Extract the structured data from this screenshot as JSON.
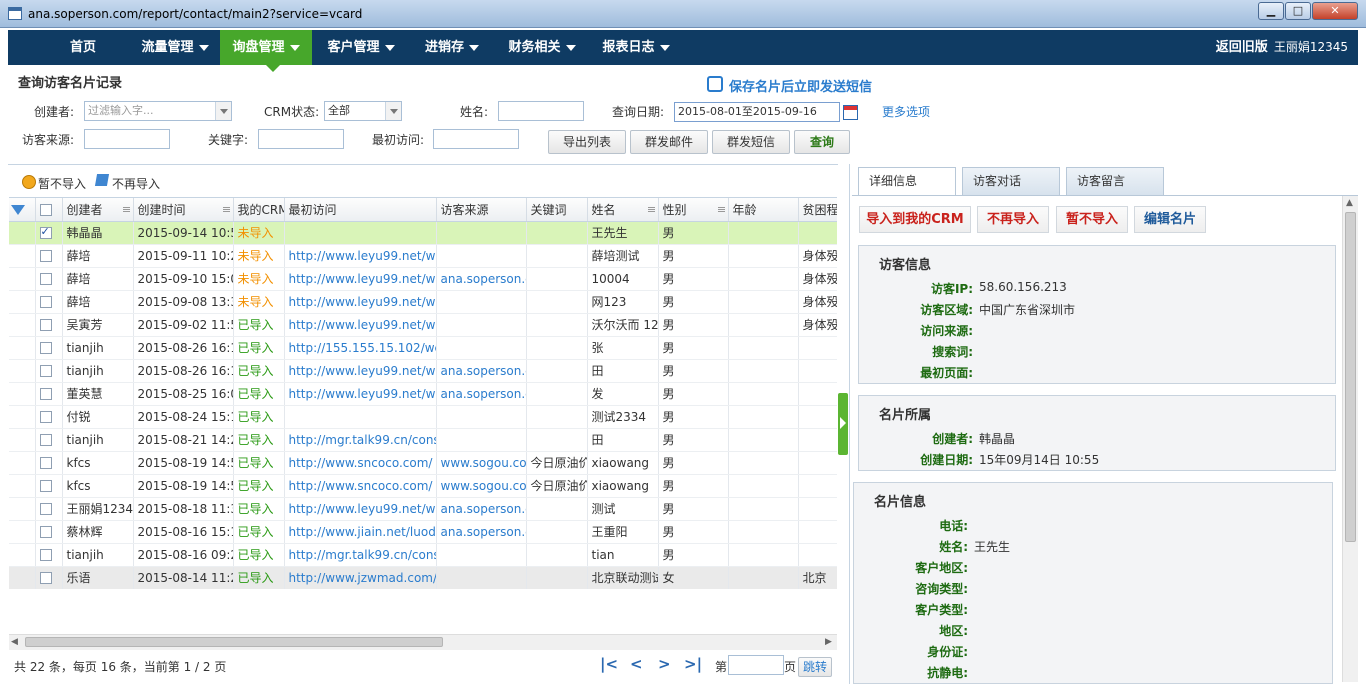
{
  "window": {
    "url": "ana.soperson.com/report/contact/main2?service=vcard",
    "min": "▁",
    "max": "□",
    "close": "✕"
  },
  "nav": {
    "items": [
      "首页",
      "流量管理",
      "询盘管理",
      "客户管理",
      "进销存",
      "财务相关",
      "报表日志"
    ],
    "back": "返回旧版",
    "user": "王丽娟12345"
  },
  "page": {
    "title": "查询访客名片记录",
    "save_sms": "保存名片后立即发送短信"
  },
  "filters": {
    "creator_label": "创建者:",
    "creator_placeholder": "过滤输入字...",
    "crm_label": "CRM状态:",
    "crm_value": "全部",
    "name_label": "姓名:",
    "name_value": "",
    "date_label": "查询日期:",
    "date_value": "2015-08-01至2015-09-16",
    "more": "更多选项",
    "source_label": "访客来源:",
    "keyword_label": "关键字:",
    "first_label": "最初访问:"
  },
  "buttons": {
    "export": "导出列表",
    "mail": "群发邮件",
    "sms": "群发短信",
    "query": "查询"
  },
  "toolbar": {
    "pause": "暂不导入",
    "never": "不再导入"
  },
  "columns": [
    "创建者",
    "创建时间",
    "我的CRM",
    "最初访问",
    "访客来源",
    "关键词",
    "姓名",
    "性别",
    "年龄",
    "贫困程"
  ],
  "rows": [
    {
      "creator": "韩晶晶",
      "time": "2015-09-14 10:55",
      "crm": "未导入",
      "first": "",
      "source": "",
      "kw": "",
      "name": "王先生",
      "sex": "男",
      "age": "",
      "extra": "",
      "checked": true
    },
    {
      "creator": "薛培",
      "time": "2015-09-11 10:26",
      "crm": "未导入",
      "first": "http://www.leyu99.net/w",
      "source": "",
      "kw": "",
      "name": "薛培测试",
      "sex": "男",
      "age": "",
      "extra": "身体殁"
    },
    {
      "creator": "薛培",
      "time": "2015-09-10 15:08",
      "crm": "未导入",
      "first": "http://www.leyu99.net/w",
      "source": "ana.soperson.co",
      "kw": "",
      "name": "10004",
      "sex": "男",
      "age": "",
      "extra": "身体殁"
    },
    {
      "creator": "薛培",
      "time": "2015-09-08 13:38",
      "crm": "未导入",
      "first": "http://www.leyu99.net/w",
      "source": "",
      "kw": "",
      "name": "网123",
      "sex": "男",
      "age": "",
      "extra": "身体殁"
    },
    {
      "creator": "吴寅芳",
      "time": "2015-09-02 11:57",
      "crm": "已导入",
      "first": "http://www.leyu99.net/w",
      "source": "",
      "kw": "",
      "name": "沃尔沃而 12",
      "sex": "男",
      "age": "",
      "extra": "身体殁"
    },
    {
      "creator": "tianjih",
      "time": "2015-08-26 16:19",
      "crm": "已导入",
      "first": "http://155.155.15.102/we",
      "source": "",
      "kw": "",
      "name": "张",
      "sex": "男",
      "age": "",
      "extra": ""
    },
    {
      "creator": "tianjih",
      "time": "2015-08-26 16:19",
      "crm": "已导入",
      "first": "http://www.leyu99.net/w",
      "source": "ana.soperson.co",
      "kw": "",
      "name": "田",
      "sex": "男",
      "age": "",
      "extra": ""
    },
    {
      "creator": "董英慧",
      "time": "2015-08-25 16:00",
      "crm": "已导入",
      "first": "http://www.leyu99.net/w",
      "source": "ana.soperson.co",
      "kw": "",
      "name": "发",
      "sex": "男",
      "age": "",
      "extra": ""
    },
    {
      "creator": "付锐",
      "time": "2015-08-24 15:12",
      "crm": "已导入",
      "first": "",
      "source": "",
      "kw": "",
      "name": "测试2334",
      "sex": "男",
      "age": "",
      "extra": ""
    },
    {
      "creator": "tianjih",
      "time": "2015-08-21 14:27",
      "crm": "已导入",
      "first": "http://mgr.talk99.cn/cons",
      "source": "",
      "kw": "",
      "name": "田",
      "sex": "男",
      "age": "",
      "extra": ""
    },
    {
      "creator": "kfcs",
      "time": "2015-08-19 14:54",
      "crm": "已导入",
      "first": "http://www.sncoco.com/",
      "source": "www.sogou.co",
      "kw": "今日原油价",
      "name": "xiaowang",
      "sex": "男",
      "age": "",
      "extra": ""
    },
    {
      "creator": "kfcs",
      "time": "2015-08-19 14:54",
      "crm": "已导入",
      "first": "http://www.sncoco.com/",
      "source": "www.sogou.co",
      "kw": "今日原油价",
      "name": "xiaowang",
      "sex": "男",
      "age": "",
      "extra": ""
    },
    {
      "creator": "王丽娟12345",
      "time": "2015-08-18 11:35",
      "crm": "已导入",
      "first": "http://www.leyu99.net/w",
      "source": "ana.soperson.co",
      "kw": "",
      "name": "测试",
      "sex": "男",
      "age": "",
      "extra": ""
    },
    {
      "creator": "蔡林辉",
      "time": "2015-08-16 15:14",
      "crm": "已导入",
      "first": "http://www.jiain.net/luodi",
      "source": "ana.soperson.co",
      "kw": "",
      "name": "王重阳",
      "sex": "男",
      "age": "",
      "extra": ""
    },
    {
      "creator": "tianjih",
      "time": "2015-08-16 09:29",
      "crm": "已导入",
      "first": "http://mgr.talk99.cn/cons",
      "source": "",
      "kw": "",
      "name": "tian",
      "sex": "男",
      "age": "",
      "extra": ""
    },
    {
      "creator": "乐语",
      "time": "2015-08-14 11:28",
      "crm": "已导入",
      "first": "http://www.jzwmad.com/",
      "source": "",
      "kw": "",
      "name": "北京联动测试",
      "sex": "女",
      "age": "",
      "extra": "北京"
    }
  ],
  "pager": {
    "summary": "共 22 条，每页 16 条，当前第 1 / 2 页",
    "page_prefix": "第",
    "page_suffix": "页",
    "jump": "跳转"
  },
  "tabs": [
    "详细信息",
    "访客对话",
    "访客留言"
  ],
  "actions": {
    "import": "导入到我的CRM",
    "never": "不再导入",
    "pause": "暂不导入",
    "edit": "编辑名片"
  },
  "visitor": {
    "title": "访客信息",
    "fields": [
      {
        "label": "访客IP:",
        "value": "58.60.156.213"
      },
      {
        "label": "访客区域:",
        "value": "中国广东省深圳市"
      },
      {
        "label": "访问来源:",
        "value": ""
      },
      {
        "label": "搜索词:",
        "value": ""
      },
      {
        "label": "最初页面:",
        "value": ""
      }
    ]
  },
  "owner": {
    "title": "名片所属",
    "fields": [
      {
        "label": "创建者:",
        "value": "韩晶晶"
      },
      {
        "label": "创建日期:",
        "value": "15年09月14日 10:55"
      }
    ]
  },
  "card": {
    "title": "名片信息",
    "fields": [
      {
        "label": "电话:",
        "value": ""
      },
      {
        "label": "姓名:",
        "value": "王先生"
      },
      {
        "label": "客户地区:",
        "value": ""
      },
      {
        "label": "咨询类型:",
        "value": ""
      },
      {
        "label": "客户类型:",
        "value": ""
      },
      {
        "label": "地区:",
        "value": ""
      },
      {
        "label": "身份证:",
        "value": ""
      },
      {
        "label": "抗静电:",
        "value": ""
      }
    ]
  }
}
